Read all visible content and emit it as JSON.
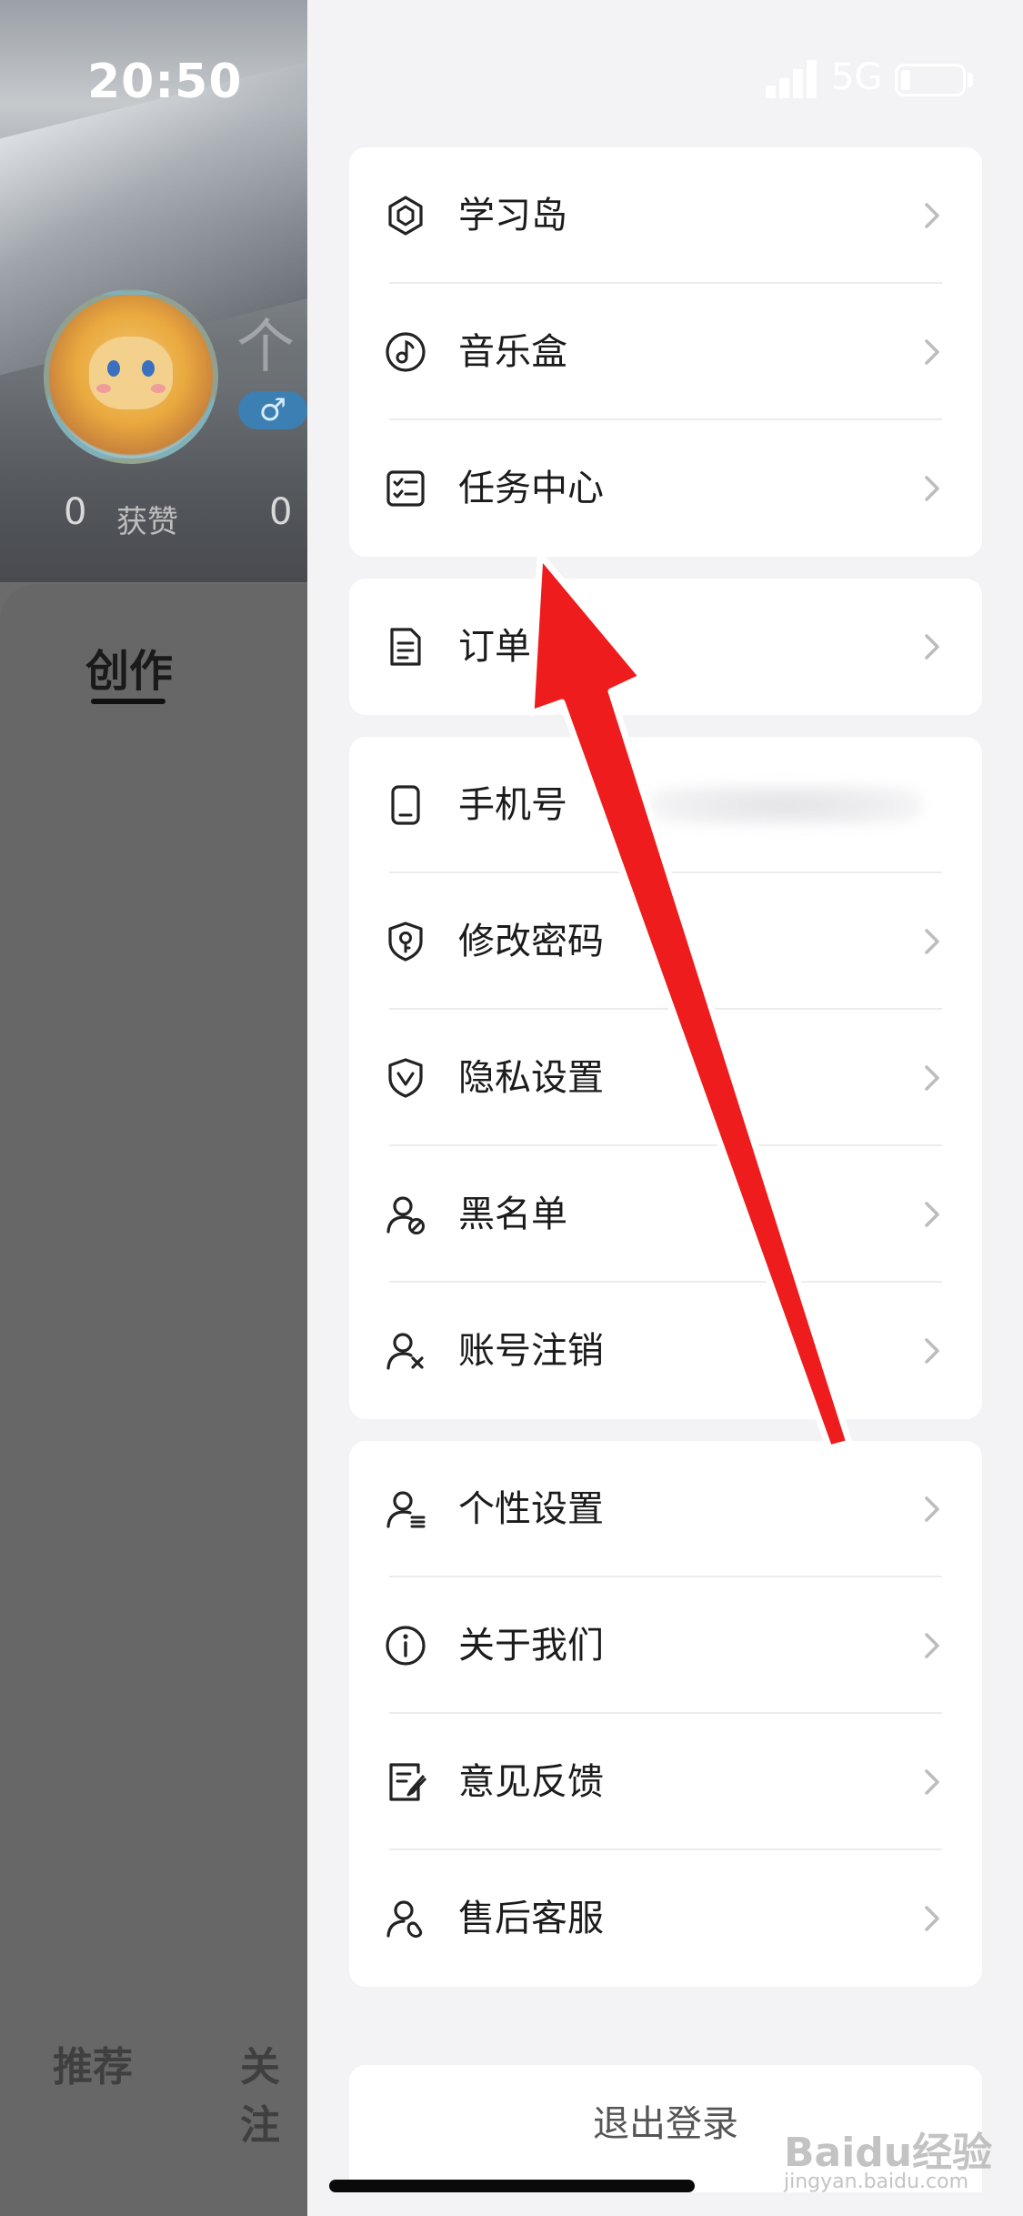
{
  "status_bar": {
    "time": "20:50",
    "network": "5G",
    "battery_level": 0.15
  },
  "profile_bg": {
    "likes_count": "0",
    "likes_label": "获赞",
    "second_count": "0",
    "gender_symbol": "♂",
    "name_partial": "个",
    "tab_create": "创作",
    "bottom_tabs": [
      "推荐",
      "关注"
    ]
  },
  "menu": {
    "groups": [
      {
        "items": [
          {
            "label": "学习岛",
            "icon": "cube-icon"
          },
          {
            "label": "音乐盒",
            "icon": "music-note-icon"
          },
          {
            "label": "任务中心",
            "icon": "checklist-icon"
          }
        ]
      },
      {
        "items": [
          {
            "label": "订单",
            "icon": "document-icon"
          }
        ]
      },
      {
        "items": [
          {
            "label": "手机号",
            "icon": "phone-icon"
          },
          {
            "label": "修改密码",
            "icon": "shield-key-icon"
          },
          {
            "label": "隐私设置",
            "icon": "shield-check-icon"
          },
          {
            "label": "黑名单",
            "icon": "user-block-icon"
          },
          {
            "label": "账号注销",
            "icon": "user-remove-icon"
          }
        ]
      },
      {
        "items": [
          {
            "label": "个性设置",
            "icon": "user-settings-icon"
          },
          {
            "label": "关于我们",
            "icon": "info-icon"
          },
          {
            "label": "意见反馈",
            "icon": "feedback-icon"
          },
          {
            "label": "售后客服",
            "icon": "customer-service-icon"
          }
        ]
      }
    ],
    "logout_label": "退出登录"
  },
  "watermark": {
    "main": "Baidu经验",
    "sub": "jingyan.baidu.com"
  },
  "colors": {
    "arrow": "#ee1c1c",
    "accent_gender": "#3b7fb3"
  }
}
